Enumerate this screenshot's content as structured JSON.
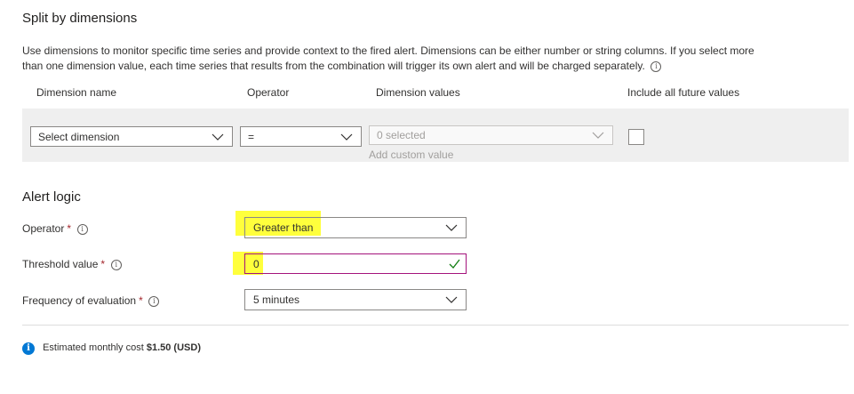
{
  "split": {
    "title": "Split by dimensions",
    "description_line1": "Use dimensions to monitor specific time series and provide context to the fired alert. Dimensions can be either number or string columns. If you select more",
    "description_line2": "than one dimension value, each time series that results from the combination will trigger its own alert and will be charged separately.",
    "columns": {
      "dimension_name": "Dimension name",
      "operator": "Operator",
      "dimension_values": "Dimension values",
      "include_future": "Include all future values"
    },
    "row": {
      "dimension_name_value": "Select dimension",
      "operator_value": "=",
      "dimension_values_value": "0 selected",
      "add_custom_value": "Add custom value",
      "include_future_checked": false
    }
  },
  "alert_logic": {
    "title": "Alert logic",
    "operator": {
      "label": "Operator",
      "value": "Greater than"
    },
    "threshold": {
      "label": "Threshold value",
      "value": "0"
    },
    "frequency": {
      "label": "Frequency of evaluation",
      "value": "5 minutes"
    },
    "required_marker": "*",
    "info_glyph": "i"
  },
  "cost": {
    "prefix": "Estimated monthly cost",
    "amount": "$1.50 (USD)"
  },
  "colors": {
    "highlight": "#ffff3c",
    "valid_check": "#107c10",
    "focus_border": "#a4137c",
    "info_blue": "#0078d4"
  }
}
